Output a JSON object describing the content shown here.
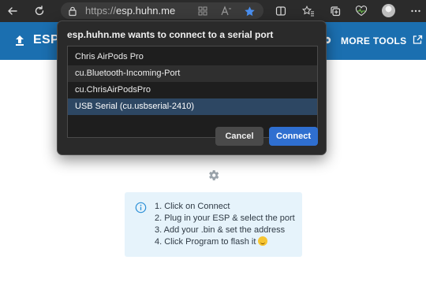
{
  "browser": {
    "url_scheme": "https://",
    "url_host": "esp.huhn.me",
    "icons": [
      "back-icon",
      "refresh-icon",
      "home-icon",
      "site-info-icon",
      "app-grid-icon",
      "read-aloud-icon",
      "favorite-star-icon",
      "split-screen-icon",
      "favorites-icon",
      "collections-icon",
      "browser-essentials-icon",
      "profile-avatar",
      "more-icon"
    ]
  },
  "app": {
    "title": "ESP",
    "more_tools_label": "MORE TOOLS",
    "header_color": "#1b6fb0"
  },
  "dialog": {
    "title": "esp.huhn.me wants to connect to a serial port",
    "ports": [
      {
        "label": "Chris AirPods Pro"
      },
      {
        "label": "cu.Bluetooth-Incoming-Port"
      },
      {
        "label": "cu.ChrisAirPodsPro"
      },
      {
        "label": "USB Serial (cu.usbserial-2410)",
        "selected": true
      }
    ],
    "cancel_label": "Cancel",
    "connect_label": "Connect",
    "accent_color": "#2f6fd0"
  },
  "instructions": {
    "steps": [
      "1. Click on Connect",
      "2. Plug in your ESP & select the port",
      "3. Add your .bin & set the address",
      "4. Click Program to flash it"
    ]
  }
}
